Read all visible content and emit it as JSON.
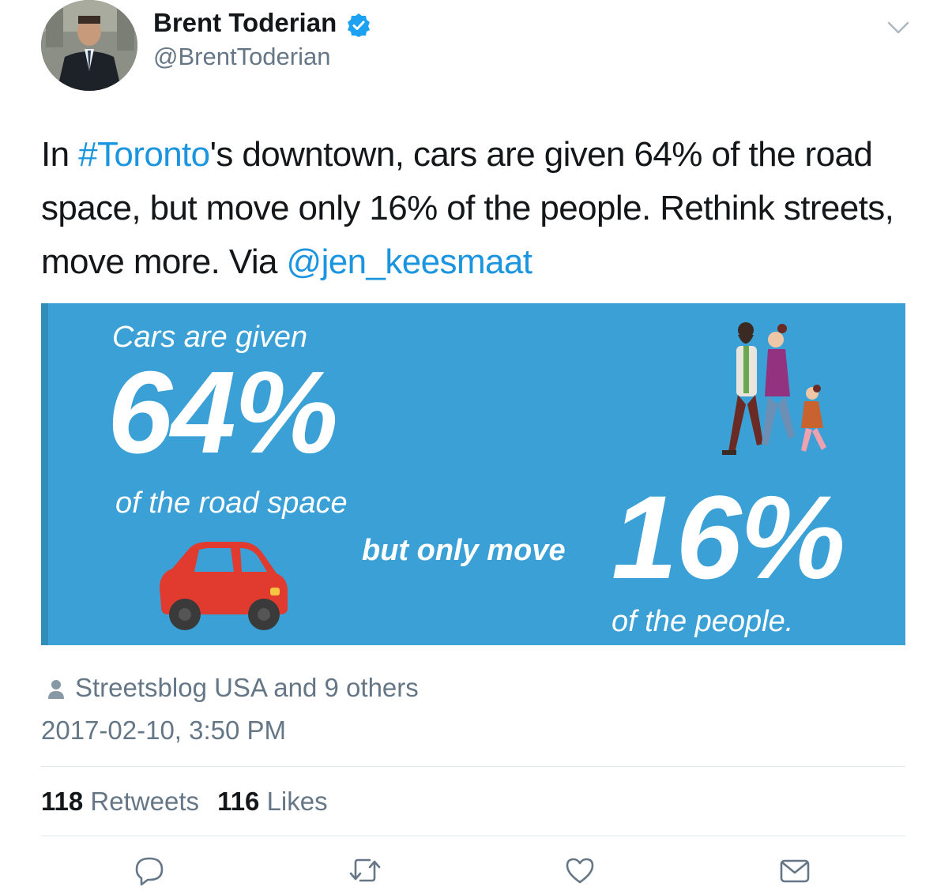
{
  "colors": {
    "link": "#1b95e0",
    "secondary_text": "#657786",
    "infographic_bg": "#3aa0d5",
    "car_red": "#e03b2e",
    "verified_blue": "#1da1f2"
  },
  "author": {
    "name": "Brent Toderian",
    "handle": "@BrentToderian",
    "verified_icon": "verified-badge-icon",
    "menu_icon": "chevron-down-icon"
  },
  "tweet": {
    "text_part1": "In ",
    "hashtag": "#Toronto",
    "text_part2": "'s downtown, cars are given 64% of the road space, but move only 16% of the people. Rethink streets, move more. Via ",
    "mention": "@jen_keesmaat"
  },
  "infographic": {
    "given_label": "Cars are given",
    "given_value": "64%",
    "road_label": "of the road space",
    "only_label": "but only move",
    "move_value": "16%",
    "people_label": "of the people."
  },
  "meta": {
    "liked_by": "Streetsblog USA and 9 others",
    "timestamp": "2017-02-10, 3:50 PM"
  },
  "stats": {
    "retweets_count": "118",
    "retweets_label": "Retweets",
    "likes_count": "116",
    "likes_label": "Likes"
  },
  "actions": [
    "reply-icon",
    "retweet-icon",
    "like-icon",
    "share-icon"
  ]
}
